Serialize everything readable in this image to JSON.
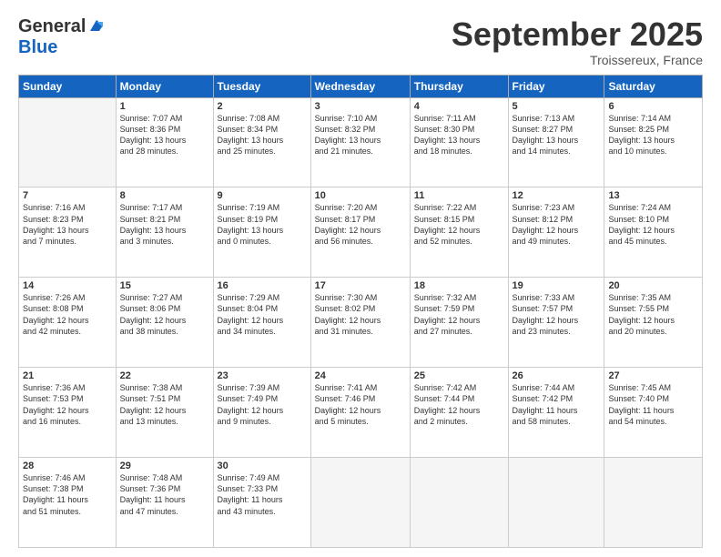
{
  "header": {
    "logo_general": "General",
    "logo_blue": "Blue",
    "month_title": "September 2025",
    "location": "Troissereux, France"
  },
  "weekdays": [
    "Sunday",
    "Monday",
    "Tuesday",
    "Wednesday",
    "Thursday",
    "Friday",
    "Saturday"
  ],
  "weeks": [
    [
      {
        "day": "",
        "info": ""
      },
      {
        "day": "1",
        "info": "Sunrise: 7:07 AM\nSunset: 8:36 PM\nDaylight: 13 hours\nand 28 minutes."
      },
      {
        "day": "2",
        "info": "Sunrise: 7:08 AM\nSunset: 8:34 PM\nDaylight: 13 hours\nand 25 minutes."
      },
      {
        "day": "3",
        "info": "Sunrise: 7:10 AM\nSunset: 8:32 PM\nDaylight: 13 hours\nand 21 minutes."
      },
      {
        "day": "4",
        "info": "Sunrise: 7:11 AM\nSunset: 8:30 PM\nDaylight: 13 hours\nand 18 minutes."
      },
      {
        "day": "5",
        "info": "Sunrise: 7:13 AM\nSunset: 8:27 PM\nDaylight: 13 hours\nand 14 minutes."
      },
      {
        "day": "6",
        "info": "Sunrise: 7:14 AM\nSunset: 8:25 PM\nDaylight: 13 hours\nand 10 minutes."
      }
    ],
    [
      {
        "day": "7",
        "info": "Sunrise: 7:16 AM\nSunset: 8:23 PM\nDaylight: 13 hours\nand 7 minutes."
      },
      {
        "day": "8",
        "info": "Sunrise: 7:17 AM\nSunset: 8:21 PM\nDaylight: 13 hours\nand 3 minutes."
      },
      {
        "day": "9",
        "info": "Sunrise: 7:19 AM\nSunset: 8:19 PM\nDaylight: 13 hours\nand 0 minutes."
      },
      {
        "day": "10",
        "info": "Sunrise: 7:20 AM\nSunset: 8:17 PM\nDaylight: 12 hours\nand 56 minutes."
      },
      {
        "day": "11",
        "info": "Sunrise: 7:22 AM\nSunset: 8:15 PM\nDaylight: 12 hours\nand 52 minutes."
      },
      {
        "day": "12",
        "info": "Sunrise: 7:23 AM\nSunset: 8:12 PM\nDaylight: 12 hours\nand 49 minutes."
      },
      {
        "day": "13",
        "info": "Sunrise: 7:24 AM\nSunset: 8:10 PM\nDaylight: 12 hours\nand 45 minutes."
      }
    ],
    [
      {
        "day": "14",
        "info": "Sunrise: 7:26 AM\nSunset: 8:08 PM\nDaylight: 12 hours\nand 42 minutes."
      },
      {
        "day": "15",
        "info": "Sunrise: 7:27 AM\nSunset: 8:06 PM\nDaylight: 12 hours\nand 38 minutes."
      },
      {
        "day": "16",
        "info": "Sunrise: 7:29 AM\nSunset: 8:04 PM\nDaylight: 12 hours\nand 34 minutes."
      },
      {
        "day": "17",
        "info": "Sunrise: 7:30 AM\nSunset: 8:02 PM\nDaylight: 12 hours\nand 31 minutes."
      },
      {
        "day": "18",
        "info": "Sunrise: 7:32 AM\nSunset: 7:59 PM\nDaylight: 12 hours\nand 27 minutes."
      },
      {
        "day": "19",
        "info": "Sunrise: 7:33 AM\nSunset: 7:57 PM\nDaylight: 12 hours\nand 23 minutes."
      },
      {
        "day": "20",
        "info": "Sunrise: 7:35 AM\nSunset: 7:55 PM\nDaylight: 12 hours\nand 20 minutes."
      }
    ],
    [
      {
        "day": "21",
        "info": "Sunrise: 7:36 AM\nSunset: 7:53 PM\nDaylight: 12 hours\nand 16 minutes."
      },
      {
        "day": "22",
        "info": "Sunrise: 7:38 AM\nSunset: 7:51 PM\nDaylight: 12 hours\nand 13 minutes."
      },
      {
        "day": "23",
        "info": "Sunrise: 7:39 AM\nSunset: 7:49 PM\nDaylight: 12 hours\nand 9 minutes."
      },
      {
        "day": "24",
        "info": "Sunrise: 7:41 AM\nSunset: 7:46 PM\nDaylight: 12 hours\nand 5 minutes."
      },
      {
        "day": "25",
        "info": "Sunrise: 7:42 AM\nSunset: 7:44 PM\nDaylight: 12 hours\nand 2 minutes."
      },
      {
        "day": "26",
        "info": "Sunrise: 7:44 AM\nSunset: 7:42 PM\nDaylight: 11 hours\nand 58 minutes."
      },
      {
        "day": "27",
        "info": "Sunrise: 7:45 AM\nSunset: 7:40 PM\nDaylight: 11 hours\nand 54 minutes."
      }
    ],
    [
      {
        "day": "28",
        "info": "Sunrise: 7:46 AM\nSunset: 7:38 PM\nDaylight: 11 hours\nand 51 minutes."
      },
      {
        "day": "29",
        "info": "Sunrise: 7:48 AM\nSunset: 7:36 PM\nDaylight: 11 hours\nand 47 minutes."
      },
      {
        "day": "30",
        "info": "Sunrise: 7:49 AM\nSunset: 7:33 PM\nDaylight: 11 hours\nand 43 minutes."
      },
      {
        "day": "",
        "info": ""
      },
      {
        "day": "",
        "info": ""
      },
      {
        "day": "",
        "info": ""
      },
      {
        "day": "",
        "info": ""
      }
    ]
  ]
}
